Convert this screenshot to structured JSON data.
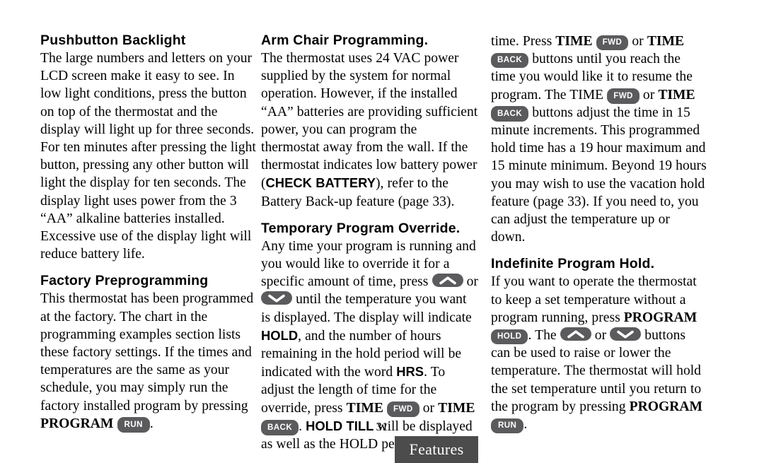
{
  "page": {
    "number": "31",
    "tab_label": "Features",
    "tab_color": "#4c4c4c",
    "button_color": "#5b5b5d",
    "background": "#ffffff"
  },
  "buttons": {
    "run": "RUN",
    "hold": "HOLD",
    "fwd": "FWD",
    "back": "BACK",
    "up": "up-arrow",
    "down": "down-arrow"
  },
  "column1": {
    "section1": {
      "heading": "Pushbutton Backlight",
      "body": "The large numbers and letters on your LCD screen make it easy to see. In low light conditions, press the button on top of the thermostat and the display will light up for three seconds. For ten minutes after pressing the light button, pressing any other button will light the display for ten seconds. The display light uses power from the 3 “AA” alkaline batteries installed. Excessive use of the display light will reduce battery life."
    },
    "section2": {
      "heading": "Factory Preprogramming",
      "body_1": "This thermostat has been programmed at the factory. The chart in the programming examples section lists these factory settings. If the times and temperatures are the same as your schedule, you may simply run the factory installed program by pressing ",
      "program_label": "PROGRAM",
      "body_2": "."
    }
  },
  "column2": {
    "section1": {
      "heading": "Arm Chair Programming.",
      "body_1": "The thermostat uses 24 VAC power supplied by the system for normal operation. However, if the installed “AA” batteries are providing sufficient power, you can program the thermostat away from the wall. If the thermostat indicates low battery power (",
      "check_battery_label": "CHECK BATTERY",
      "body_2": "), refer to the Battery Back-up feature (page 33)."
    },
    "section2": {
      "heading": "Temporary Program Override.",
      "body_1": "Any time your program is running and you would like to override it for a specific amount of time, press ",
      "body_2": " or ",
      "body_3": " until the temperature you want is displayed. The display will indicate ",
      "hold_label": "HOLD",
      "body_4": ", and the number of hours remaining in the hold period will be indicated with the word ",
      "hrs_label": "HRS",
      "body_5": ". To adjust the length of time for the override, press ",
      "time_label_1": "TIME",
      "body_6": " or ",
      "time_label_2": "TIME",
      "body_7": ". ",
      "hold_till_label": "HOLD TILL",
      "body_8": " will be displayed as well as the HOLD period expiration"
    }
  },
  "column3": {
    "section1": {
      "body_1": "time. Press ",
      "time_label_1": "TIME",
      "body_2": " or ",
      "time_label_2": "TIME",
      "body_3": " buttons until you reach the time you would like it to resume the program. The TIME ",
      "body_4": " or ",
      "time_label_3": "TIME",
      "body_5": " buttons adjust the time in 15 minute increments. This programmed hold time has a 19 hour maximum and 15 minute minimum. Beyond 19 hours you may wish to use the vacation hold feature (page 33). If you need to, you can adjust the temperature up or down."
    },
    "section2": {
      "heading": "Indefinite Program Hold.",
      "body_1": "If you want to operate the thermostat to keep a set temperature without a program running, press ",
      "program_label_1": "PROGRAM",
      "body_2": ". The ",
      "body_3": " or ",
      "body_4": " buttons can be used to raise or lower the temperature. The thermostat will hold the set temperature until you return to the program by pressing ",
      "program_label_2": "PROGRAM",
      "body_5": "."
    }
  }
}
